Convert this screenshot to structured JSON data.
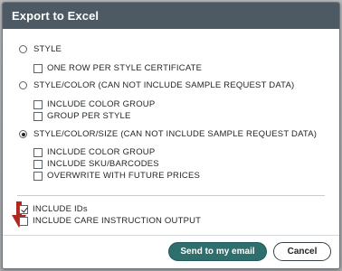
{
  "dialog": {
    "title": "Export to Excel"
  },
  "options": {
    "style": {
      "label": "STYLE",
      "selected": false,
      "sub": [
        {
          "label": "ONE ROW PER STYLE CERTIFICATE",
          "checked": false
        }
      ]
    },
    "style_color": {
      "label": "STYLE/COLOR (CAN NOT INCLUDE SAMPLE REQUEST DATA)",
      "selected": false,
      "sub": [
        {
          "label": "INCLUDE COLOR GROUP",
          "checked": false
        },
        {
          "label": "GROUP PER STYLE",
          "checked": false
        }
      ]
    },
    "style_color_size": {
      "label": "STYLE/COLOR/SIZE (CAN NOT INCLUDE SAMPLE REQUEST DATA)",
      "selected": true,
      "sub": [
        {
          "label": "INCLUDE COLOR GROUP",
          "checked": false
        },
        {
          "label": "INCLUDE SKU/BARCODES",
          "checked": false
        },
        {
          "label": "OVERWRITE WITH FUTURE PRICES",
          "checked": false
        }
      ]
    }
  },
  "extras": [
    {
      "label": "INCLUDE IDs",
      "checked": true
    },
    {
      "label": "INCLUDE CARE INSTRUCTION OUTPUT",
      "checked": false
    }
  ],
  "footer": {
    "primary_label": "Send to my email",
    "secondary_label": "Cancel"
  },
  "colors": {
    "titlebar": "#4e5a63",
    "primary_button": "#2e6e6d",
    "arrow": "#b3261e"
  },
  "icons": {
    "annotation": "red-arrow-icon"
  }
}
